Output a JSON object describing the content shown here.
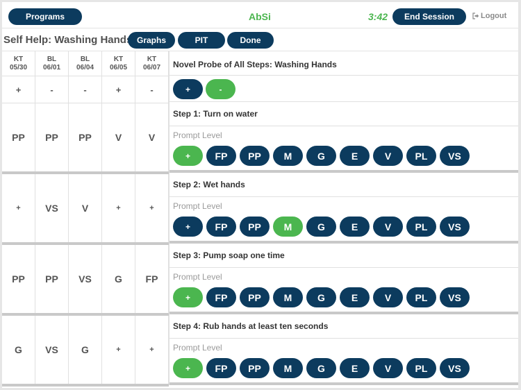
{
  "header": {
    "programs_label": "Programs",
    "app_title": "AbSi",
    "timer": "3:42",
    "end_session_label": "End Session",
    "logout_label": "Logout",
    "logout_icon": "sign-out-icon"
  },
  "titlebar": {
    "program_title": "Self Help: Washing Hands",
    "graphs_label": "Graphs",
    "pit_label": "PIT",
    "done_label": "Done"
  },
  "colors": {
    "primary": "#0c3b5e",
    "selected": "#4bb64f",
    "divider": "#c9c9c9"
  },
  "sessions": [
    {
      "type": "KT",
      "date": "05/30"
    },
    {
      "type": "BL",
      "date": "06/01"
    },
    {
      "type": "BL",
      "date": "06/04"
    },
    {
      "type": "KT",
      "date": "06/05"
    },
    {
      "type": "KT",
      "date": "06/07"
    }
  ],
  "probe": {
    "title": "Novel Probe of All Steps: Washing Hands",
    "history": [
      "+",
      "-",
      "-",
      "+",
      "-"
    ],
    "options": [
      {
        "label": "+",
        "selected": false
      },
      {
        "label": "-",
        "selected": true
      }
    ]
  },
  "prompt_level_label": "Prompt Level",
  "prompt_options": [
    "+",
    "FP",
    "PP",
    "M",
    "G",
    "E",
    "V",
    "PL",
    "VS"
  ],
  "steps": [
    {
      "title": "Step 1: Turn on water",
      "history": [
        "PP",
        "PP",
        "PP",
        "V",
        "V"
      ],
      "selected": "+"
    },
    {
      "title": "Step 2: Wet hands",
      "history": [
        "+",
        "VS",
        "V",
        "+",
        "+"
      ],
      "selected": "M"
    },
    {
      "title": "Step 3: Pump soap one time",
      "history": [
        "PP",
        "PP",
        "VS",
        "G",
        "FP"
      ],
      "selected": "+"
    },
    {
      "title": "Step 4: Rub hands at least ten seconds",
      "history": [
        "G",
        "VS",
        "G",
        "+",
        "+"
      ],
      "selected": "+"
    }
  ]
}
